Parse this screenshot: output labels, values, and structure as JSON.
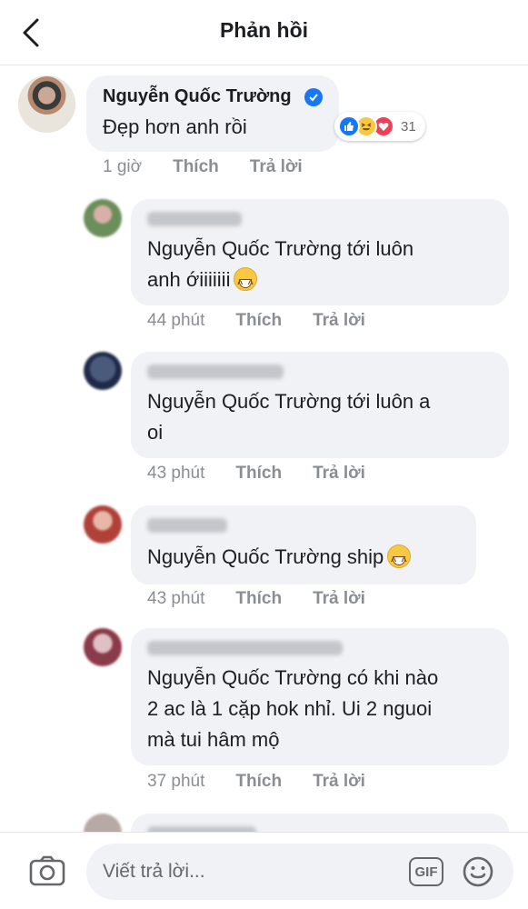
{
  "header": {
    "title": "Phản hồi"
  },
  "main_comment": {
    "author": "Nguyễn Quốc Trường",
    "text": "Đẹp hơn anh rồi",
    "reaction_count": "31",
    "time": "1 giờ",
    "like_label": "Thích",
    "reply_label": "Trả lời"
  },
  "replies": [
    {
      "text": "Nguyễn Quốc Trường tới luôn\nanh ớiiiiiii",
      "time": "44 phút",
      "like_label": "Thích",
      "reply_label": "Trả lời"
    },
    {
      "text": "Nguyễn Quốc Trường  tới luôn a\noi",
      "time": "43 phút",
      "like_label": "Thích",
      "reply_label": "Trả lời"
    },
    {
      "text": "Nguyễn Quốc Trường ship",
      "time": "43 phút",
      "like_label": "Thích",
      "reply_label": "Trả lời"
    },
    {
      "text": "Nguyễn Quốc Trường có khi nào\n2 ac là 1 cặp hok nhỉ. Ui 2 nguoi\nmà tui hâm mộ",
      "time": "37 phút",
      "like_label": "Thích",
      "reply_label": "Trả lời"
    }
  ],
  "composer": {
    "placeholder": "Viết trả lời...",
    "gif_label": "GIF"
  },
  "colors": {
    "accent": "#1877f2",
    "bubble": "#f0f2f5",
    "meta_text": "#8a8d91",
    "love": "#f33e58",
    "haha": "#f7c943"
  },
  "icons": [
    "chevron-left-icon",
    "verified-badge-icon",
    "like-reaction-icon",
    "haha-reaction-icon",
    "love-reaction-icon",
    "camera-icon",
    "gif-icon",
    "emoji-icon"
  ]
}
